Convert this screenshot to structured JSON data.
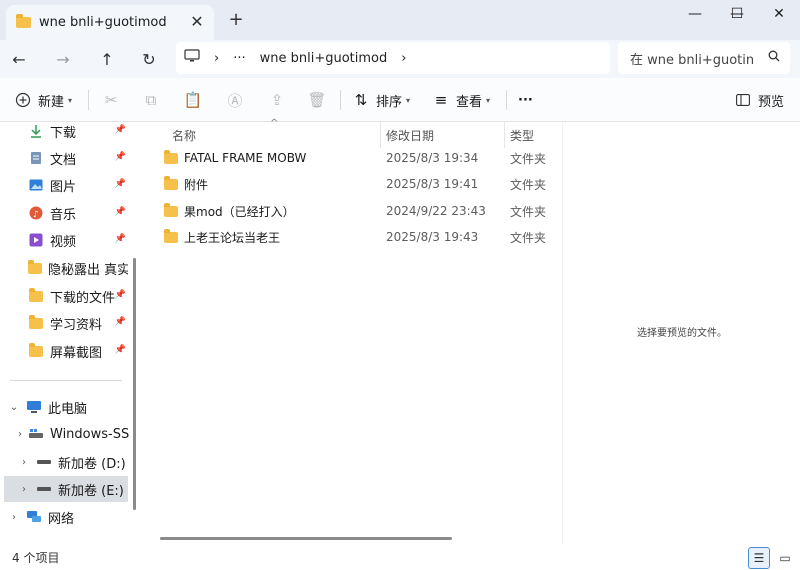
{
  "tab": {
    "title": "wne bnli+guotimod"
  },
  "window": {
    "minimize": "—",
    "maximize": "☐",
    "close": "✕"
  },
  "address": {
    "computer_icon": "computer-icon",
    "sep1": "›",
    "more": "···",
    "folder": "wne bnli+guotimod",
    "sep2": "›"
  },
  "search": {
    "placeholder": "在 wne bnli+guotin",
    "icon": "search-icon"
  },
  "toolbar": {
    "new_label": "新建",
    "sort_label": "排序",
    "view_label": "查看",
    "more_label": "···",
    "preview_label": "预览"
  },
  "sidebar": {
    "quick_access": [
      {
        "label": "下载",
        "icon": "download-icon",
        "pinned": true
      },
      {
        "label": "文档",
        "icon": "document-icon",
        "pinned": true
      },
      {
        "label": "图片",
        "icon": "pictures-icon",
        "pinned": true
      },
      {
        "label": "音乐",
        "icon": "music-icon",
        "pinned": true
      },
      {
        "label": "视频",
        "icon": "video-icon",
        "pinned": true
      },
      {
        "label": "隐秘露出 真实",
        "icon": "folder-icon",
        "pinned": false
      },
      {
        "label": "下载的文件",
        "icon": "folder-icon",
        "pinned": true
      },
      {
        "label": "学习资料",
        "icon": "folder-icon",
        "pinned": true
      },
      {
        "label": "屏幕截图",
        "icon": "folder-icon",
        "pinned": true
      }
    ],
    "this_pc": "此电脑",
    "drives": [
      {
        "label": "Windows-SSD",
        "icon": "drive-windows-icon"
      },
      {
        "label": "新加卷 (D:)",
        "icon": "drive-icon"
      },
      {
        "label": "新加卷 (E:)",
        "icon": "drive-icon"
      }
    ],
    "network": "网络"
  },
  "columns": {
    "name": "名称",
    "date": "修改日期",
    "type": "类型"
  },
  "files": [
    {
      "name": "FATAL FRAME MOBW",
      "date": "2025/8/3 19:34",
      "type": "文件夹"
    },
    {
      "name": "附件",
      "date": "2025/8/3 19:41",
      "type": "文件夹"
    },
    {
      "name": "果mod（已经打入）",
      "date": "2024/9/22 23:43",
      "type": "文件夹"
    },
    {
      "name": "上老王论坛当老王",
      "date": "2025/8/3 19:43",
      "type": "文件夹"
    }
  ],
  "preview": {
    "message": "选择要预览的文件。"
  },
  "status": {
    "count": "4 个项目"
  },
  "colors": {
    "titlebar": "#e6ebf4",
    "folder": "#f5c14a",
    "accent": "#4a8cd4"
  }
}
